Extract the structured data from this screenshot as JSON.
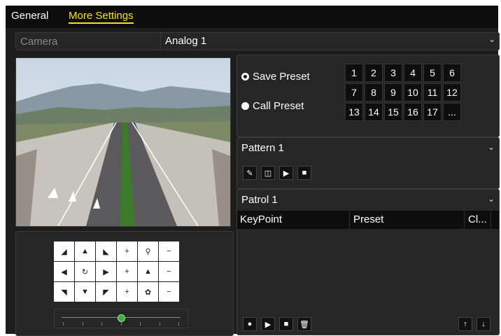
{
  "tabs": [
    {
      "label": "General"
    },
    {
      "label": "More Settings"
    }
  ],
  "camera": {
    "label": "Camera",
    "value": "Analog 1"
  },
  "presets": {
    "save_label": "Save Preset",
    "call_label": "Call Preset",
    "selected": "save",
    "buttons": [
      "1",
      "2",
      "3",
      "4",
      "5",
      "6",
      "7",
      "8",
      "9",
      "10",
      "11",
      "12",
      "13",
      "14",
      "15",
      "16",
      "17",
      "..."
    ]
  },
  "pattern": {
    "value": "Pattern 1",
    "icons": [
      "edit-icon",
      "save-icon",
      "play-icon",
      "stop-icon"
    ]
  },
  "patrol": {
    "value": "Patrol 1",
    "columns": [
      "KeyPoint",
      "Preset",
      "Cl..."
    ],
    "icons": [
      "add-icon",
      "play-icon",
      "stop-icon",
      "delete-icon"
    ],
    "move_icons": [
      "arrow-up-icon",
      "arrow-down-icon"
    ]
  },
  "ptz": {
    "icons": [
      "arrow-up-left-icon",
      "arrow-up-icon",
      "arrow-up-right-icon",
      "zoom-plus-icon",
      "zoom-icon",
      "zoom-minus-icon",
      "arrow-left-icon",
      "auto-rotate-icon",
      "arrow-right-icon",
      "focus-plus-icon",
      "focus-icon",
      "focus-minus-icon",
      "arrow-down-left-icon",
      "arrow-down-icon",
      "arrow-down-right-icon",
      "iris-plus-icon",
      "iris-icon",
      "iris-minus-icon"
    ],
    "speed_level": 0.5
  },
  "colors": {
    "accent": "#f5e21c",
    "panel": "#262626",
    "header": "#0d0d0d"
  }
}
